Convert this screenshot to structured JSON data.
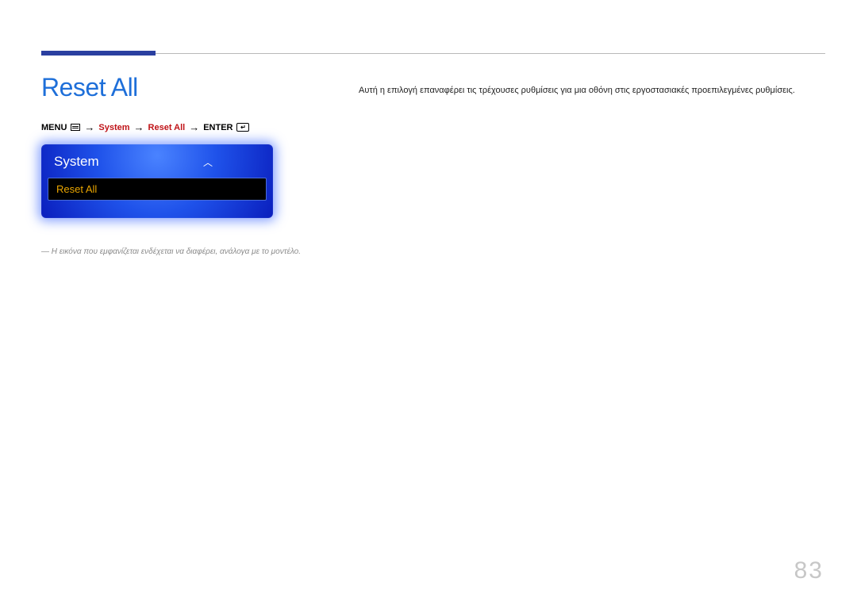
{
  "page_title": "Reset All",
  "breadcrumb": {
    "menu": "MENU",
    "system": "System",
    "reset_all": "Reset All",
    "enter": "ENTER"
  },
  "osd": {
    "title": "System",
    "item": "Reset All"
  },
  "disclaimer": "Η εικόνα που εμφανίζεται ενδέχεται να διαφέρει, ανάλογα με το μοντέλο.",
  "body_text": "Αυτή η επιλογή επαναφέρει τις τρέχουσες ρυθμίσεις για μια οθόνη στις εργοστασιακές προεπιλεγμένες ρυθμίσεις.",
  "page_number": "83"
}
